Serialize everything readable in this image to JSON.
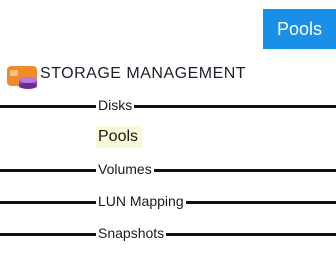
{
  "top_tab": {
    "label": "Pools"
  },
  "section": {
    "title": "STORAGE MANAGEMENT",
    "icon": "storage-pool-icon"
  },
  "nav": {
    "items": [
      {
        "label": "Disks",
        "active": false
      },
      {
        "label": "Pools",
        "active": true
      },
      {
        "label": "Volumes",
        "active": false
      },
      {
        "label": "LUN Mapping",
        "active": false
      },
      {
        "label": "Snapshots",
        "active": false
      }
    ]
  },
  "colors": {
    "tab_background": "#1a8fe8",
    "active_item_background": "#f7f9d9",
    "icon_orange": "#f08a2c",
    "icon_purple": "#8a3fb8"
  }
}
